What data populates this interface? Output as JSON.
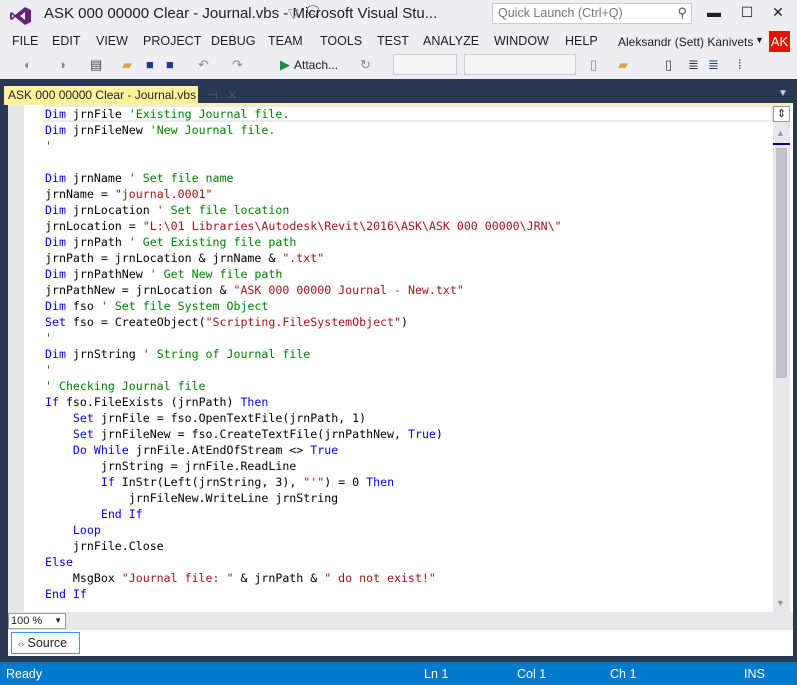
{
  "window": {
    "title": "ASK 000 00000 Clear - Journal.vbs - Microsoft Visual Stu...",
    "quick_launch_placeholder": "Quick Launch (Ctrl+Q)",
    "minimize": "▬",
    "maximize": "☐",
    "close": "✕"
  },
  "menu": [
    "FILE",
    "EDIT",
    "VIEW",
    "PROJECT",
    "DEBUG",
    "TEAM",
    "TOOLS",
    "TEST",
    "ANALYZE",
    "WINDOW",
    "HELP"
  ],
  "user": {
    "name": "Aleksandr (Sett) Kanivets",
    "initials": "AK"
  },
  "toolbar": {
    "attach_label": "Attach..."
  },
  "tab": {
    "label": "ASK 000 00000 Clear - Journal.vbs",
    "pin": "⊣",
    "close": "✕"
  },
  "code": [
    [
      [
        "kw",
        "Dim"
      ],
      [
        "tx",
        " jrnFile "
      ],
      [
        "cm",
        "'Existing Journal file."
      ]
    ],
    [
      [
        "kw",
        "Dim"
      ],
      [
        "tx",
        " jrnFileNew "
      ],
      [
        "cm",
        "'New Journal file."
      ]
    ],
    [
      [
        "cm",
        "'"
      ]
    ],
    [],
    [
      [
        "kw",
        "Dim"
      ],
      [
        "tx",
        " jrnName "
      ],
      [
        "cm",
        "' Set file name"
      ]
    ],
    [
      [
        "tx",
        "jrnName = "
      ],
      [
        "st",
        "\"journal.0001\""
      ]
    ],
    [
      [
        "kw",
        "Dim"
      ],
      [
        "tx",
        " jrnLocation "
      ],
      [
        "cm",
        "' Set file location"
      ]
    ],
    [
      [
        "tx",
        "jrnLocation = "
      ],
      [
        "st",
        "\"L:\\01 Libraries\\Autodesk\\Revit\\2016\\ASK\\ASK 000 00000\\JRN\\\""
      ]
    ],
    [
      [
        "kw",
        "Dim"
      ],
      [
        "tx",
        " jrnPath "
      ],
      [
        "cm",
        "' Get Existing file path"
      ]
    ],
    [
      [
        "tx",
        "jrnPath = jrnLocation & jrnName & "
      ],
      [
        "st",
        "\".txt\""
      ]
    ],
    [
      [
        "kw",
        "Dim"
      ],
      [
        "tx",
        " jrnPathNew "
      ],
      [
        "cm",
        "' Get New file path"
      ]
    ],
    [
      [
        "tx",
        "jrnPathNew = jrnLocation & "
      ],
      [
        "st",
        "\"ASK 000 00000 Journal - New.txt\""
      ]
    ],
    [
      [
        "kw",
        "Dim"
      ],
      [
        "tx",
        " fso "
      ],
      [
        "cm",
        "' Set file System Object"
      ]
    ],
    [
      [
        "kw",
        "Set"
      ],
      [
        "tx",
        " fso = CreateObject("
      ],
      [
        "st",
        "\"Scripting.FileSystemObject\""
      ],
      [
        "tx",
        ")"
      ]
    ],
    [
      [
        "cm",
        "'"
      ]
    ],
    [
      [
        "kw",
        "Dim"
      ],
      [
        "tx",
        " jrnString "
      ],
      [
        "cm",
        "' String of Journal file"
      ]
    ],
    [
      [
        "cm",
        "'"
      ]
    ],
    [
      [
        "cm",
        "' Checking Journal file"
      ]
    ],
    [
      [
        "kw",
        "If"
      ],
      [
        "tx",
        " fso.FileExists (jrnPath) "
      ],
      [
        "kw",
        "Then"
      ]
    ],
    [
      [
        "tx",
        "    "
      ],
      [
        "kw",
        "Set"
      ],
      [
        "tx",
        " jrnFile = fso.OpenTextFile(jrnPath, 1)"
      ]
    ],
    [
      [
        "tx",
        "    "
      ],
      [
        "kw",
        "Set"
      ],
      [
        "tx",
        " jrnFileNew = fso.CreateTextFile(jrnPathNew, "
      ],
      [
        "kw",
        "True"
      ],
      [
        "tx",
        ")"
      ]
    ],
    [
      [
        "tx",
        "    "
      ],
      [
        "kw",
        "Do While"
      ],
      [
        "tx",
        " jrnFile.AtEndOfStream <> "
      ],
      [
        "kw",
        "True"
      ]
    ],
    [
      [
        "tx",
        "        jrnString = jrnFile.ReadLine"
      ]
    ],
    [
      [
        "tx",
        "        "
      ],
      [
        "kw",
        "If"
      ],
      [
        "tx",
        " InStr(Left(jrnString, 3), "
      ],
      [
        "st",
        "\"'\""
      ],
      [
        "tx",
        ") = 0 "
      ],
      [
        "kw",
        "Then"
      ]
    ],
    [
      [
        "tx",
        "            jrnFileNew.WriteLine jrnString"
      ]
    ],
    [
      [
        "tx",
        "        "
      ],
      [
        "kw",
        "End If"
      ]
    ],
    [
      [
        "tx",
        "    "
      ],
      [
        "kw",
        "Loop"
      ]
    ],
    [
      [
        "tx",
        "    jrnFile.Close"
      ]
    ],
    [
      [
        "kw",
        "Else"
      ]
    ],
    [
      [
        "tx",
        "    MsgBox "
      ],
      [
        "st",
        "\"Journal file: \""
      ],
      [
        "tx",
        " & jrnPath & "
      ],
      [
        "st",
        "\" do not exist!\""
      ]
    ],
    [
      [
        "kw",
        "End If"
      ]
    ]
  ],
  "editor": {
    "zoom": "100 %",
    "source_label": "Source"
  },
  "colors": {
    "keyword": "#0000ff",
    "comment": "#008000",
    "string": "#a31515",
    "status_bar": "#007acc",
    "tab_active": "#fff29d",
    "accent": "#68217a"
  },
  "status": {
    "ready": "Ready",
    "ln": "Ln 1",
    "col": "Col 1",
    "ch": "Ch 1",
    "mode": "INS"
  }
}
